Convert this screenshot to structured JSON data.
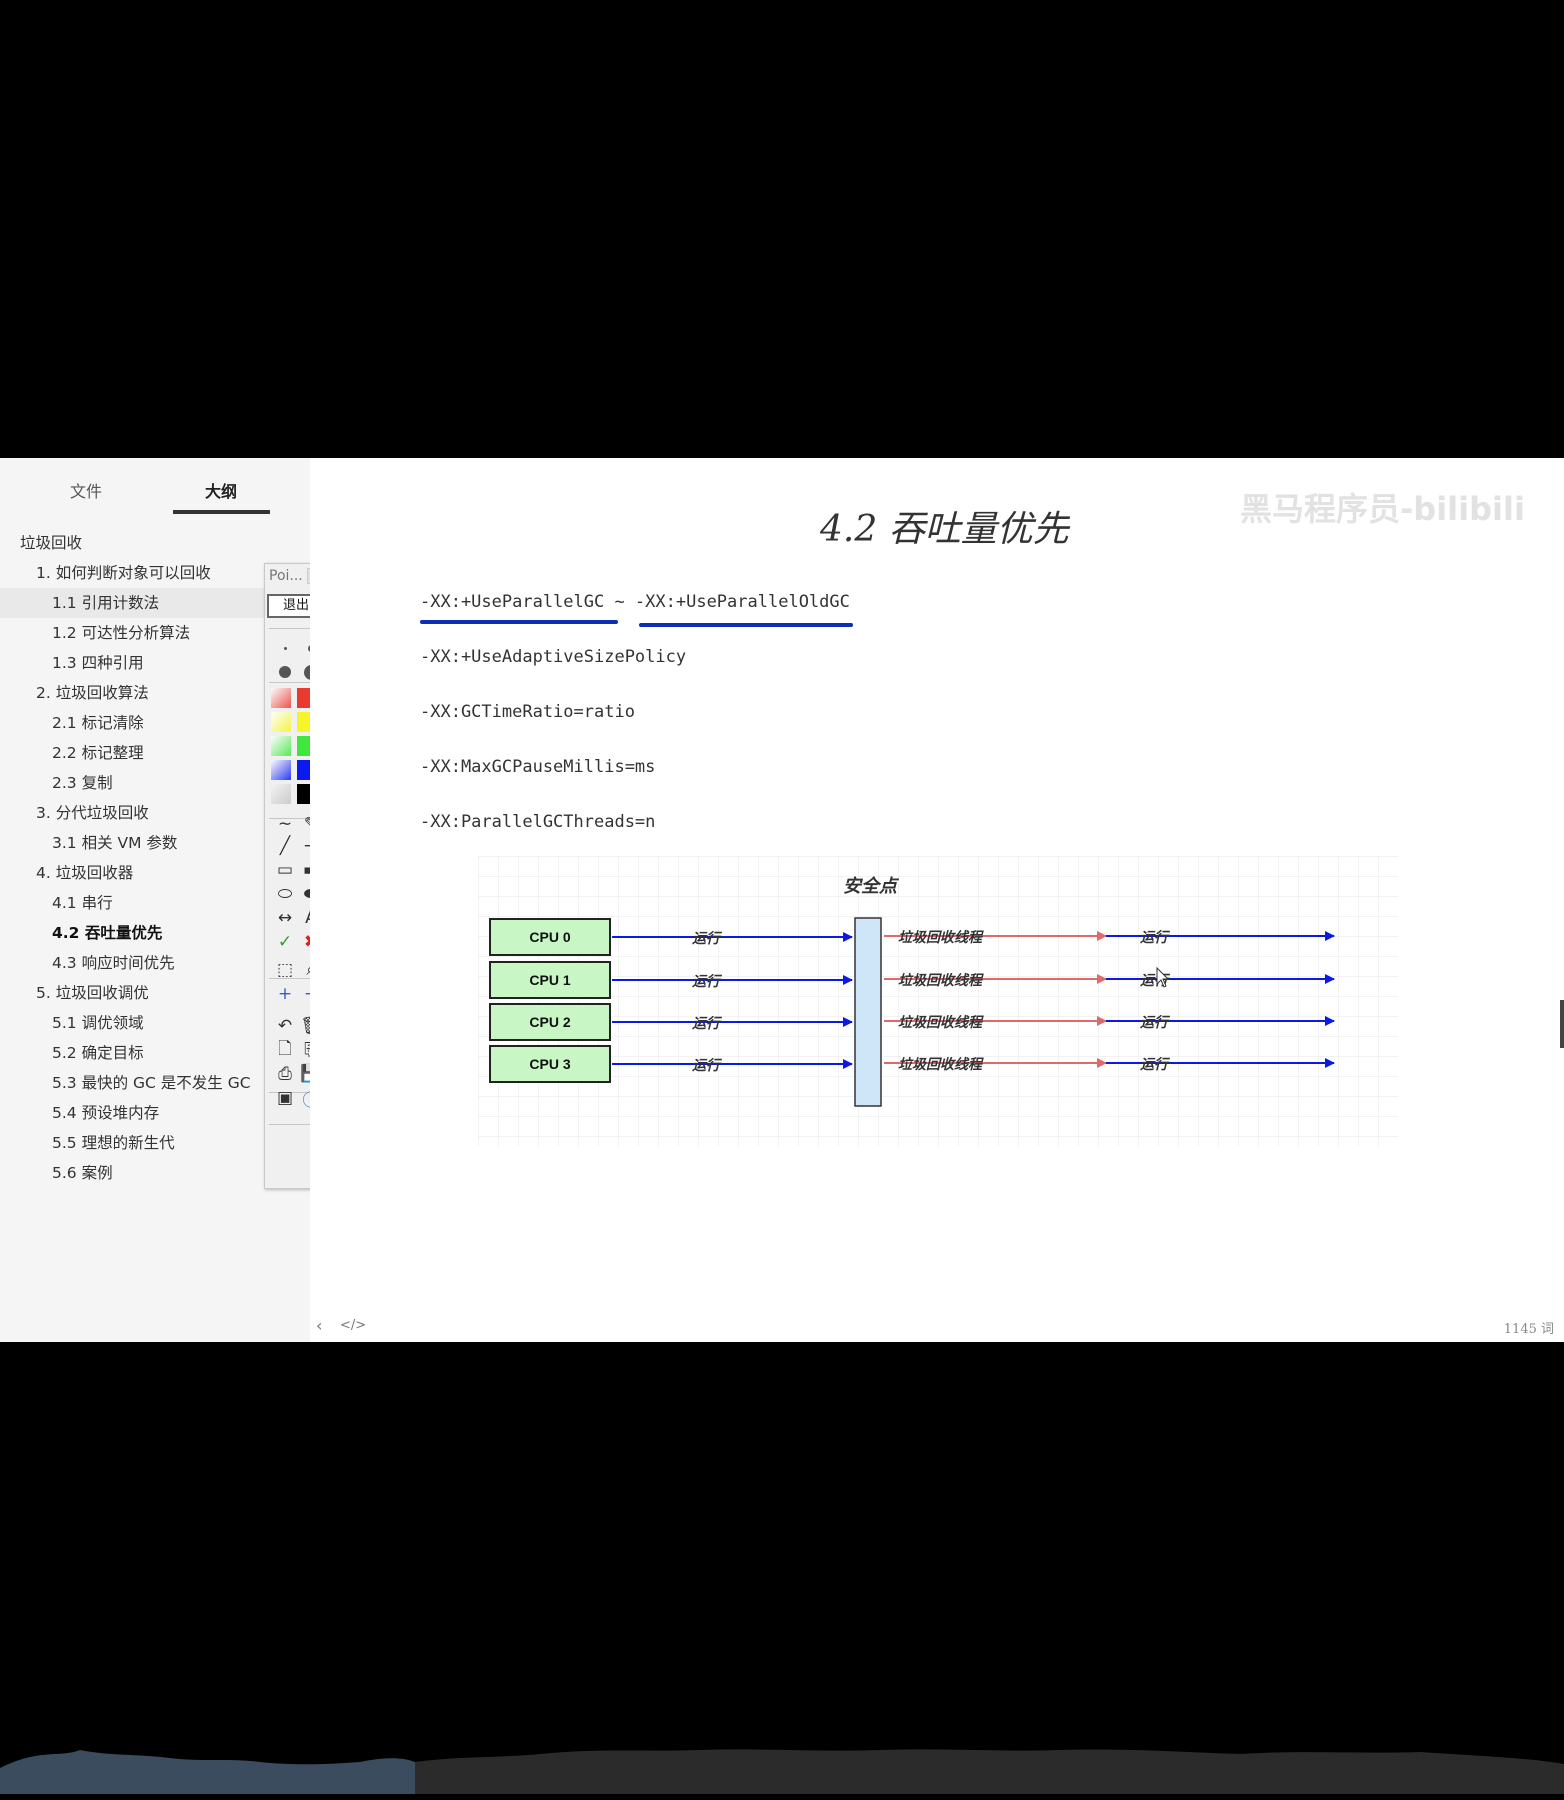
{
  "sidebar": {
    "tabs": [
      {
        "label": "文件"
      },
      {
        "label": "大纲"
      }
    ],
    "outline": [
      {
        "label": "垃圾回收",
        "level": 0
      },
      {
        "label": "1. 如何判断对象可以回收",
        "level": 1
      },
      {
        "label": "1.1 引用计数法",
        "level": 2,
        "highlighted": true
      },
      {
        "label": "1.2 可达性分析算法",
        "level": 2
      },
      {
        "label": "1.3 四种引用",
        "level": 2
      },
      {
        "label": "2. 垃圾回收算法",
        "level": 1
      },
      {
        "label": "2.1 标记清除",
        "level": 2
      },
      {
        "label": "2.2 标记整理",
        "level": 2
      },
      {
        "label": "2.3 复制",
        "level": 2
      },
      {
        "label": "3. 分代垃圾回收",
        "level": 1
      },
      {
        "label": "3.1 相关 VM 参数",
        "level": 2
      },
      {
        "label": "4. 垃圾回收器",
        "level": 1
      },
      {
        "label": "4.1 串行",
        "level": 2
      },
      {
        "label": "4.2 吞吐量优先",
        "level": 2,
        "active": true
      },
      {
        "label": "4.3 响应时间优先",
        "level": 2
      },
      {
        "label": "5. 垃圾回收调优",
        "level": 1
      },
      {
        "label": "5.1 调优领域",
        "level": 2
      },
      {
        "label": "5.2 确定目标",
        "level": 2
      },
      {
        "label": "5.3 最快的 GC 是不发生 GC",
        "level": 2
      },
      {
        "label": "5.4 预设堆内存",
        "level": 2
      },
      {
        "label": "5.5 理想的新生代",
        "level": 2
      },
      {
        "label": "5.6 案例",
        "level": 2
      }
    ]
  },
  "palette": {
    "title": "Poi...",
    "exit_label": "退出",
    "swatches": [
      "#e83a2e",
      "#f5f52a",
      "#3ee63e",
      "#0a1af0",
      "#000000"
    ],
    "tools": [
      "freehand-icon",
      "eraser-icon",
      "line-icon",
      "arrow-icon",
      "rectangle-icon",
      "filled-rectangle-icon",
      "ellipse-icon",
      "filled-ellipse-icon",
      "double-arrow-icon",
      "text-icon",
      "check-icon",
      "cross-icon",
      "crop-icon",
      "zoom-icon",
      "plus-icon",
      "minus-icon",
      "undo-icon",
      "trash-icon",
      "new-page-icon",
      "copy-icon",
      "print-icon",
      "save-icon",
      "screen-icon",
      "info-icon"
    ]
  },
  "document": {
    "title": "4.2 吞吐量优先",
    "watermark": "黑马程序员-bilibili",
    "code_lines": [
      "-XX:+UseParallelGC ~ -XX:+UseParallelOldGC",
      "-XX:+UseAdaptiveSizePolicy",
      "-XX:GCTimeRatio=ratio",
      "-XX:MaxGCPauseMillis=ms",
      "-XX:ParallelGCThreads=n"
    ],
    "word_count": "1145 词"
  },
  "diagram": {
    "safepoint_label": "安全点",
    "cpus": [
      "CPU 0",
      "CPU 1",
      "CPU 2",
      "CPU 3"
    ],
    "run_label": "运行",
    "gc_label": "垃圾回收线程",
    "colors": {
      "cpu_fill": "#c8f7c5",
      "cpu_border": "#222222",
      "safepoint_fill": "#cfe6f9",
      "run_arrow": "#0a19e6",
      "gc_arrow": "#e06a6a"
    }
  }
}
